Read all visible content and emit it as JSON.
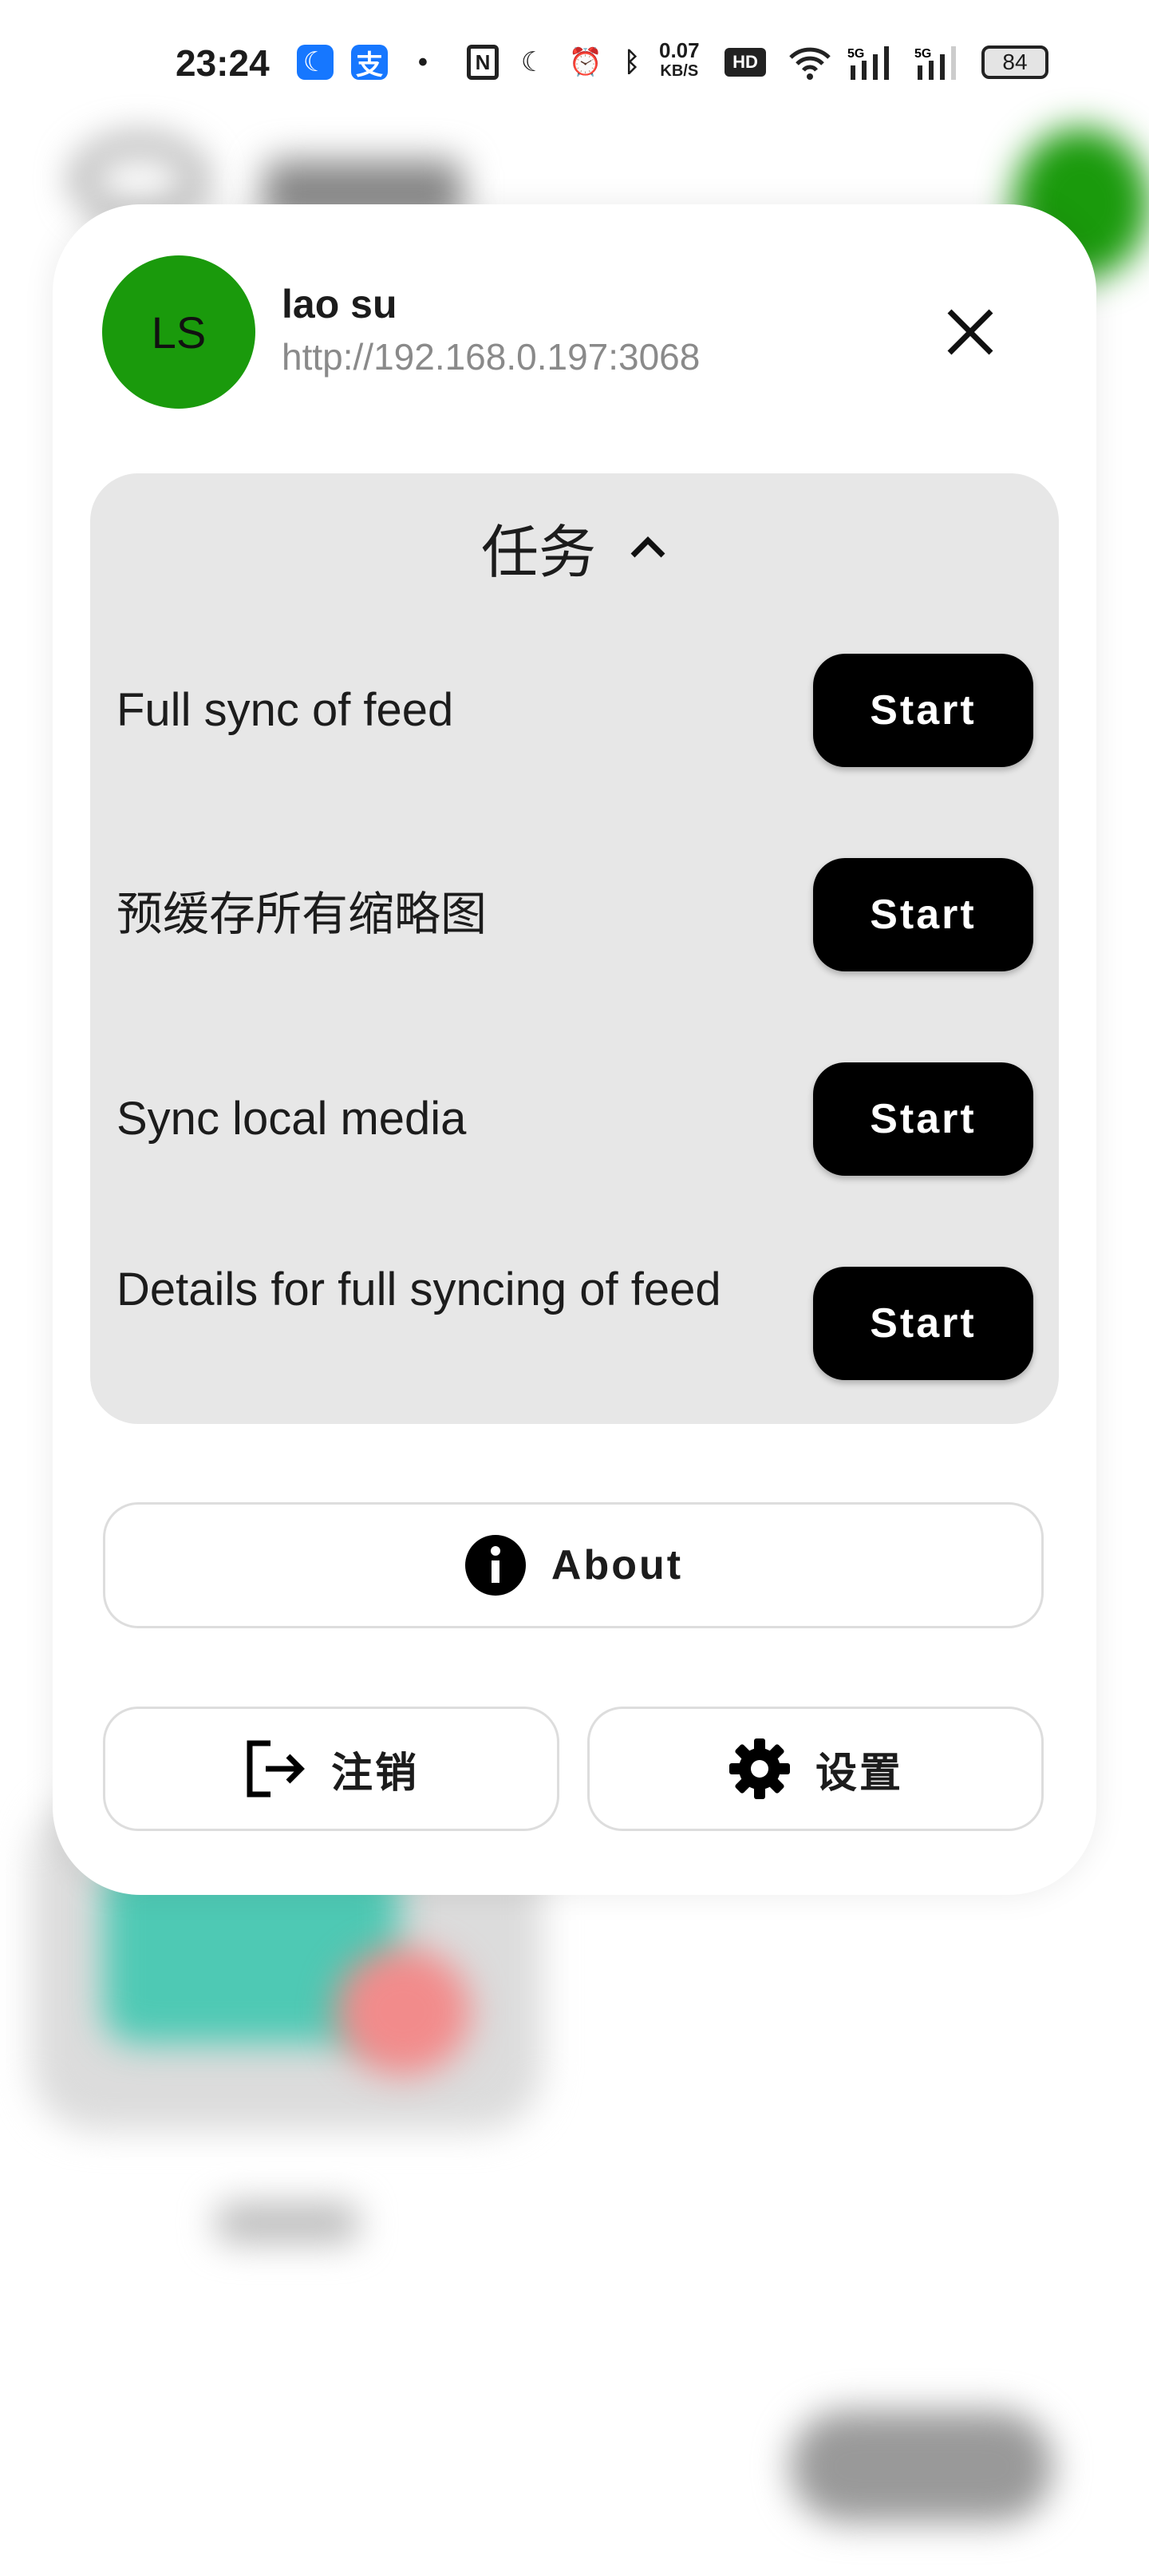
{
  "status_bar": {
    "time": "23:24",
    "net_speed": "0.07",
    "net_unit": "KB/S",
    "network": "5G",
    "battery": "84",
    "icons": [
      "moon-app-icon",
      "alipay-icon",
      "dot-icon",
      "nfc-icon",
      "dnd-moon-icon",
      "alarm-icon",
      "bluetooth-icon",
      "hd-icon",
      "wifi-icon",
      "signal-5g-icon",
      "signal-5g-icon"
    ]
  },
  "account": {
    "initials": "LS",
    "name": "lao su",
    "url": "http://192.168.0.197:3068",
    "avatar_color": "#1a9a0c"
  },
  "tasks": {
    "title": "任务",
    "items": [
      {
        "label": "Full sync of feed",
        "button": "Start"
      },
      {
        "label": "预缓存所有缩略图",
        "button": "Start"
      },
      {
        "label": "Sync local media",
        "button": "Start"
      },
      {
        "label": "Details for full syncing of feed",
        "button": "Start"
      }
    ]
  },
  "about_label": "About",
  "logout_label": "注销",
  "settings_label": "设置"
}
